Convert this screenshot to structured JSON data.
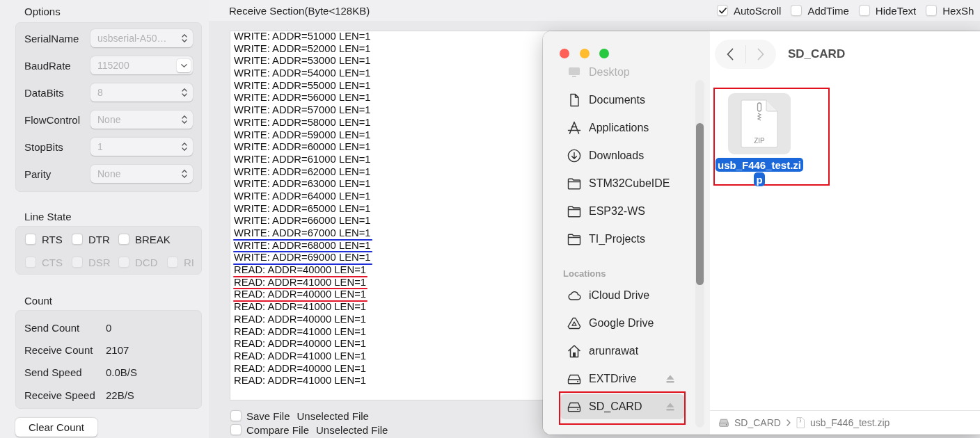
{
  "options": {
    "title": "Options",
    "fields": [
      {
        "label": "SerialName",
        "value": "usbserial-A50…",
        "kind": "popup",
        "disabled": true
      },
      {
        "label": "BaudRate",
        "value": "115200",
        "kind": "combo",
        "disabled": true
      },
      {
        "label": "DataBits",
        "value": "8",
        "kind": "popup",
        "disabled": true
      },
      {
        "label": "FlowControl",
        "value": "None",
        "kind": "popup",
        "disabled": true
      },
      {
        "label": "StopBits",
        "value": "1",
        "kind": "popup",
        "disabled": true
      },
      {
        "label": "Parity",
        "value": "None",
        "kind": "popup",
        "disabled": true
      }
    ]
  },
  "line_state": {
    "title": "Line State",
    "rows": [
      [
        {
          "label": "RTS",
          "checked": false,
          "disabled": false
        },
        {
          "label": "DTR",
          "checked": false,
          "disabled": false
        },
        {
          "label": "BREAK",
          "checked": false,
          "disabled": false
        }
      ],
      [
        {
          "label": "CTS",
          "checked": false,
          "disabled": true
        },
        {
          "label": "DSR",
          "checked": false,
          "disabled": true
        },
        {
          "label": "DCD",
          "checked": false,
          "disabled": true
        },
        {
          "label": "RI",
          "checked": false,
          "disabled": true
        }
      ]
    ]
  },
  "count": {
    "title": "Count",
    "rows": [
      {
        "label": "Send Count",
        "value": "0"
      },
      {
        "label": "Receive Count",
        "value": "2107"
      },
      {
        "label": "Send Speed",
        "value": "0.0B/S"
      },
      {
        "label": "Receive Speed",
        "value": "22B/S"
      }
    ]
  },
  "clear_button": {
    "label": "Clear Count"
  },
  "receive": {
    "title": "Receive Section(Byte<128KB)",
    "options": [
      {
        "label": "AutoScroll",
        "checked": true
      },
      {
        "label": "AddTime",
        "checked": false
      },
      {
        "label": "HideText",
        "checked": false
      },
      {
        "label": "HexSh",
        "checked": false
      }
    ],
    "lines": [
      {
        "text": "WRITE: ADDR=51000 LEN=1"
      },
      {
        "text": "WRITE: ADDR=52000 LEN=1"
      },
      {
        "text": "WRITE: ADDR=53000 LEN=1"
      },
      {
        "text": "WRITE: ADDR=54000 LEN=1"
      },
      {
        "text": "WRITE: ADDR=55000 LEN=1"
      },
      {
        "text": "WRITE: ADDR=56000 LEN=1"
      },
      {
        "text": "WRITE: ADDR=57000 LEN=1"
      },
      {
        "text": "WRITE: ADDR=58000 LEN=1"
      },
      {
        "text": "WRITE: ADDR=59000 LEN=1"
      },
      {
        "text": "WRITE: ADDR=60000 LEN=1"
      },
      {
        "text": "WRITE: ADDR=61000 LEN=1"
      },
      {
        "text": "WRITE: ADDR=62000 LEN=1"
      },
      {
        "text": "WRITE: ADDR=63000 LEN=1"
      },
      {
        "text": "WRITE: ADDR=64000 LEN=1"
      },
      {
        "text": "WRITE: ADDR=65000 LEN=1"
      },
      {
        "text": "WRITE: ADDR=66000 LEN=1"
      },
      {
        "text": "WRITE: ADDR=67000 LEN=1",
        "color": "#1f2ed6"
      },
      {
        "text": "WRITE: ADDR=68000 LEN=1",
        "color": "#1f2ed6"
      },
      {
        "text": "WRITE: ADDR=69000 LEN=1",
        "color": "#1f2ed6"
      },
      {
        "text": "READ: ADDR=40000 LEN=1",
        "color": "#e3162c"
      },
      {
        "text": "READ: ADDR=41000 LEN=1",
        "color": "#e3162c"
      },
      {
        "text": "READ: ADDR=40000 LEN=1",
        "color": "#e3162c"
      },
      {
        "text": "READ: ADDR=41000 LEN=1"
      },
      {
        "text": "READ: ADDR=40000 LEN=1"
      },
      {
        "text": "READ: ADDR=41000 LEN=1"
      },
      {
        "text": "READ: ADDR=40000 LEN=1"
      },
      {
        "text": "READ: ADDR=41000 LEN=1"
      },
      {
        "text": "READ: ADDR=40000 LEN=1"
      },
      {
        "text": "READ: ADDR=41000 LEN=1"
      }
    ]
  },
  "file_rows": [
    {
      "label": "Save File",
      "file": "Unselected File",
      "checked": false
    },
    {
      "label": "Compare File",
      "file": "Unselected File",
      "checked": false
    }
  ],
  "finder": {
    "favorites": [
      {
        "label": "Desktop",
        "kind": "display",
        "dimmed": true,
        "selected": false
      },
      {
        "label": "Documents",
        "kind": "document",
        "dimmed": false,
        "selected": false
      },
      {
        "label": "Applications",
        "kind": "apps",
        "dimmed": false,
        "selected": false
      },
      {
        "label": "Downloads",
        "kind": "download",
        "dimmed": false,
        "selected": false
      },
      {
        "label": "STM32CubeIDE",
        "kind": "folder",
        "dimmed": false,
        "selected": false
      },
      {
        "label": "ESP32-WS",
        "kind": "folder",
        "dimmed": false,
        "selected": false
      },
      {
        "label": "TI_Projects",
        "kind": "folder",
        "dimmed": false,
        "selected": false
      }
    ],
    "locations": {
      "title": "Locations",
      "items": [
        {
          "label": "iCloud Drive",
          "kind": "cloud",
          "selected": false,
          "ejectable": false,
          "boxed": false
        },
        {
          "label": "Google Drive",
          "kind": "triangle",
          "selected": false,
          "ejectable": false,
          "boxed": false
        },
        {
          "label": "arunrawat",
          "kind": "home",
          "selected": false,
          "ejectable": false,
          "boxed": false
        },
        {
          "label": "EXTDrive",
          "kind": "disk",
          "selected": false,
          "ejectable": true,
          "boxed": false
        },
        {
          "label": "SD_CARD",
          "kind": "disk",
          "selected": true,
          "ejectable": true,
          "boxed": true
        }
      ]
    },
    "nav": [
      {
        "kind": "back",
        "disabled": false
      },
      {
        "kind": "forward",
        "disabled": true
      }
    ],
    "title": "SD_CARD",
    "items": [
      {
        "name": "usb_F446_test.zip",
        "type_label": "ZIP",
        "selected": true,
        "boxed": true
      }
    ],
    "path": [
      {
        "label": "SD_CARD",
        "kind": "disk"
      },
      {
        "label": "usb_F446_test.zip",
        "kind": "zip"
      }
    ]
  }
}
